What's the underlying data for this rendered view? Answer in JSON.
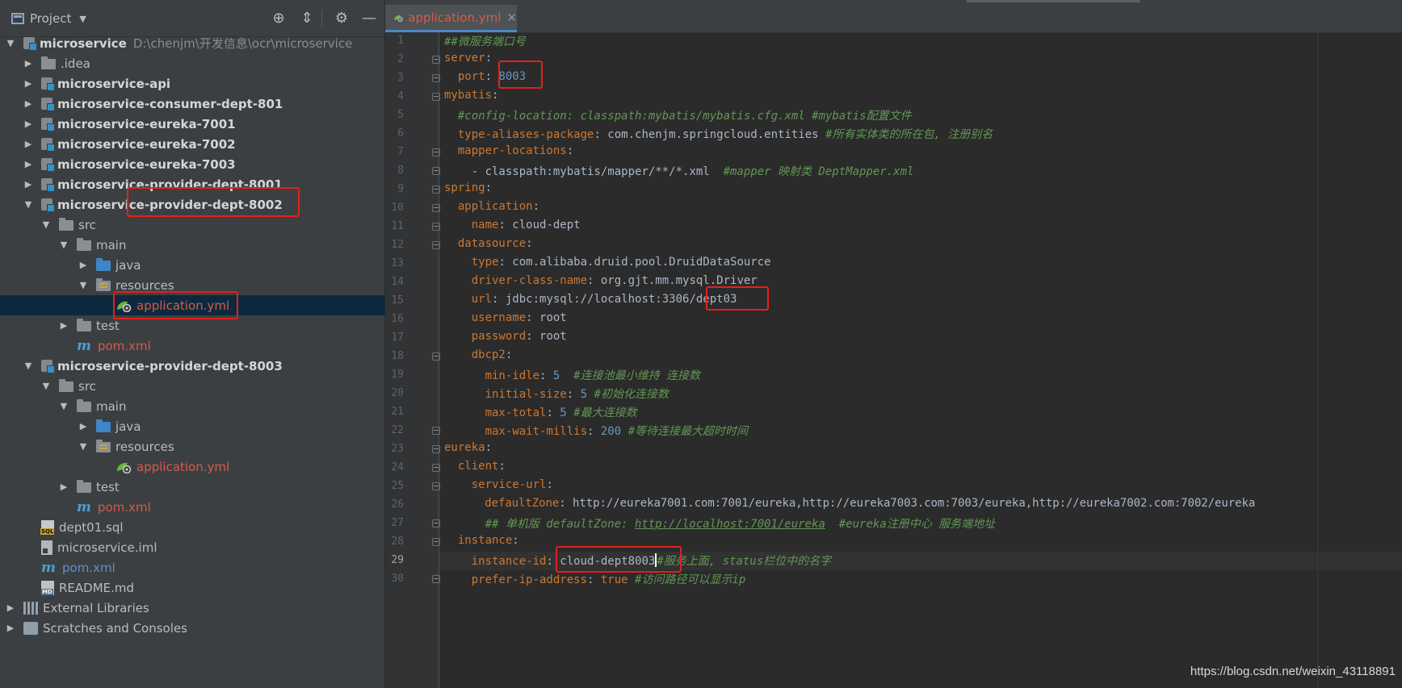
{
  "project_panel": {
    "title": "Project",
    "tree": [
      {
        "label": "microservice",
        "path": "D:\\chenjm\\开发信息\\ocr\\microservice"
      },
      {
        "label": ".idea"
      },
      {
        "label": "microservice-api"
      },
      {
        "label": "microservice-consumer-dept-801"
      },
      {
        "label": "microservice-eureka-7001"
      },
      {
        "label": "microservice-eureka-7002"
      },
      {
        "label": "microservice-eureka-7003"
      },
      {
        "label": "microservice-provider-dept-8001"
      },
      {
        "label": "microservice-provider-dept-8002"
      },
      {
        "label": "src"
      },
      {
        "label": "main"
      },
      {
        "label": "java"
      },
      {
        "label": "resources"
      },
      {
        "label": "application.yml"
      },
      {
        "label": "test"
      },
      {
        "label": "pom.xml"
      },
      {
        "label": "microservice-provider-dept-8003"
      },
      {
        "label": "src"
      },
      {
        "label": "main"
      },
      {
        "label": "java"
      },
      {
        "label": "resources"
      },
      {
        "label": "application.yml"
      },
      {
        "label": "test"
      },
      {
        "label": "pom.xml"
      },
      {
        "label": "dept01.sql"
      },
      {
        "label": "microservice.iml"
      },
      {
        "label": "pom.xml"
      },
      {
        "label": "README.md"
      },
      {
        "label": "External Libraries"
      },
      {
        "label": "Scratches and Consoles"
      }
    ]
  },
  "editor": {
    "tab_label": "application.yml",
    "close_glyph": "✕",
    "line_numbers": [
      "1",
      "2",
      "3",
      "4",
      "5",
      "6",
      "7",
      "8",
      "9",
      "10",
      "11",
      "12",
      "13",
      "14",
      "15",
      "16",
      "17",
      "18",
      "19",
      "20",
      "21",
      "22",
      "23",
      "24",
      "25",
      "26",
      "27",
      "28",
      "29",
      "30"
    ],
    "current_line": "29",
    "lines": [
      [
        "##微服务端口号"
      ],
      [
        "server",
        ":"
      ],
      [
        "  port",
        ": ",
        "8003"
      ],
      [
        "mybatis",
        ":"
      ],
      [
        "  #config-location: classpath:mybatis/mybatis.cfg.xml #mybatis配置文件"
      ],
      [
        "  type-aliases-package",
        ": com.chenjm.springcloud.entities ",
        "#所有实体类的所在包, 注册别名"
      ],
      [
        "  mapper-locations",
        ":"
      ],
      [
        "    - classpath:mybatis/mapper/**/*.xml  ",
        "#mapper 映射类 DeptMapper.xml"
      ],
      [
        "spring",
        ":"
      ],
      [
        "  application",
        ":"
      ],
      [
        "    name",
        ": cloud-dept"
      ],
      [
        "  datasource",
        ":"
      ],
      [
        "    type",
        ": com.alibaba.druid.pool.DruidDataSource"
      ],
      [
        "    driver-class-name",
        ": org.gjt.mm.mysql.Driver"
      ],
      [
        "    url",
        ": jdbc:mysql://localhost:3306/dept03"
      ],
      [
        "    username",
        ": root"
      ],
      [
        "    password",
        ": root"
      ],
      [
        "    dbcp2",
        ":"
      ],
      [
        "      min-idle",
        ": ",
        "5",
        "  #连接池最小维持 连接数"
      ],
      [
        "      initial-size",
        ": ",
        "5",
        " #初始化连接数"
      ],
      [
        "      max-total",
        ": ",
        "5",
        " #最大连接数"
      ],
      [
        "      max-wait-millis",
        ": ",
        "200",
        " #等待连接最大超时时间"
      ],
      [
        "eureka",
        ":"
      ],
      [
        "  client",
        ":"
      ],
      [
        "    service-url",
        ":"
      ],
      [
        "      defaultZone",
        ": http://eureka7001.com:7001/eureka,http://eureka7003.com:7003/eureka,http://eureka7002.com:7002/eureka"
      ],
      [
        "      ## 单机版 defaultZone: ",
        "http://localhost:7001/eureka",
        "  #eureka注册中心 服务端地址"
      ],
      [
        "  instance",
        ":"
      ],
      [
        "    instance-id",
        ": cloud-dept8003",
        "#服务上面, status栏位中的名字"
      ],
      [
        "    prefer-ip-address",
        ": ",
        "true",
        " #访问路径可以显示ip"
      ]
    ]
  },
  "watermark": "https://blog.csdn.net/weixin_43118891",
  "colors": {
    "annotation": "#e3211b",
    "selection": "#0d293e",
    "key": "#cc7832",
    "number": "#6897bb",
    "comment": "#629755",
    "modified_file": "#d65a49"
  }
}
